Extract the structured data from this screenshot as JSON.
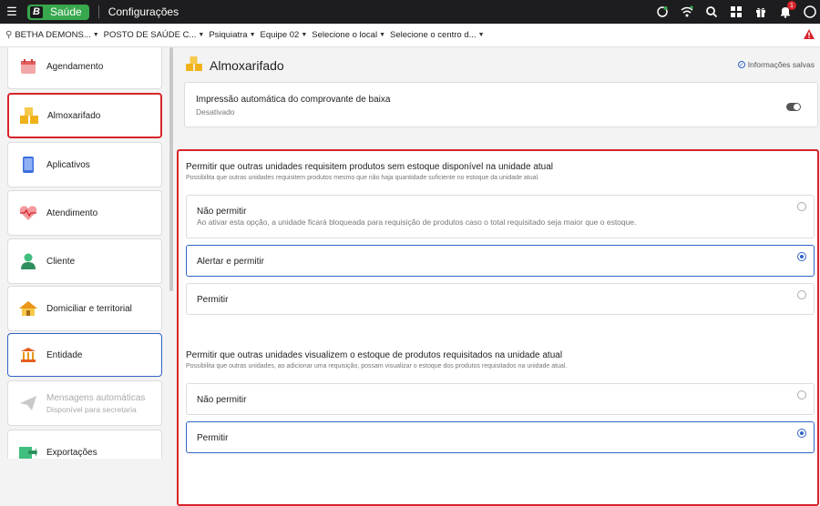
{
  "topbar": {
    "app_letter": "B",
    "app_name": "Saúde",
    "page": "Configurações",
    "notification_count": "1"
  },
  "filters": [
    {
      "label": "BETHA DEMONS..."
    },
    {
      "label": "POSTO DE SAÚDE C..."
    },
    {
      "label": "Psiquiatra"
    },
    {
      "label": "Equipe 02"
    },
    {
      "label": "Selecione o local"
    },
    {
      "label": "Selecione o centro d..."
    }
  ],
  "sidebar": {
    "items": [
      {
        "label": "Agendamento"
      },
      {
        "label": "Almoxarifado"
      },
      {
        "label": "Aplicativos"
      },
      {
        "label": "Atendimento"
      },
      {
        "label": "Cliente"
      },
      {
        "label": "Domiciliar e territorial"
      },
      {
        "label": "Entidade"
      },
      {
        "label": "Mensagens automáticas",
        "sub": "Disponível para secretaria"
      },
      {
        "label": "Exportações"
      }
    ]
  },
  "main": {
    "title": "Almoxarifado",
    "saved": "Informações salvas",
    "print_setting": {
      "label": "Impressão automática do comprovante de baixa",
      "status": "Desativado",
      "enabled": false
    },
    "group1": {
      "title": "Permitir que outras unidades requisitem produtos sem estoque disponível na unidade atual",
      "desc": "Possibilita que outras unidades requisitem produtos mesmo que não haja quantidade suficiente no estoque da unidade atual.",
      "options": [
        {
          "label": "Não permitir",
          "desc": "Ao ativar esta opção, a unidade ficará bloqueada para requisição de produtos caso o total requisitado seja maior que o estoque.",
          "selected": false
        },
        {
          "label": "Alertar e permitir",
          "selected": true
        },
        {
          "label": "Permitir",
          "selected": false
        }
      ]
    },
    "group2": {
      "title": "Permitir que outras unidades visualizem o estoque de produtos requisitados na unidade atual",
      "desc": "Possibilita que outras unidades, ao adicionar uma requisição, possam visualizar o estoque dos produtos requisitados na unidade atual.",
      "options": [
        {
          "label": "Não permitir",
          "selected": false
        },
        {
          "label": "Permitir",
          "selected": true
        }
      ]
    }
  },
  "colors": {
    "accent": "#2f63c8",
    "highlight": "#d8232a",
    "brand": "#38a84e"
  }
}
